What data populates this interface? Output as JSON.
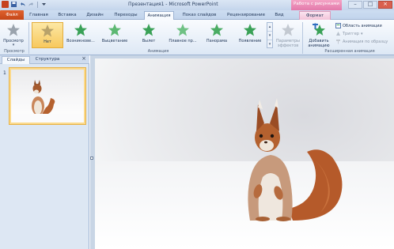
{
  "titlebar": {
    "title": "Презентация1 - Microsoft PowerPoint",
    "context_header": "Работа с рисунками"
  },
  "tabs": [
    {
      "label": "Файл"
    },
    {
      "label": "Главная"
    },
    {
      "label": "Вставка"
    },
    {
      "label": "Дизайн"
    },
    {
      "label": "Переходы"
    },
    {
      "label": "Анимация"
    },
    {
      "label": "Показ слайдов"
    },
    {
      "label": "Рецензирование"
    },
    {
      "label": "Вид"
    },
    {
      "label": "Формат"
    }
  ],
  "ribbon": {
    "preview": {
      "label": "Просмотр",
      "group_label": "Просмотр"
    },
    "animation_gallery": [
      {
        "label": "Нет"
      },
      {
        "label": "Возникнове..."
      },
      {
        "label": "Выцветание"
      },
      {
        "label": "Вылет"
      },
      {
        "label": "Плавное пр..."
      },
      {
        "label": "Панорама"
      },
      {
        "label": "Появление"
      }
    ],
    "effect_params": {
      "label_line1": "Параметры",
      "label_line2": "эффектов"
    },
    "animation_group_label": "Анимация",
    "add_animation": {
      "label_line1": "Добавить",
      "label_line2": "анимацию"
    },
    "animation_area": "Область анимации",
    "trigger": "Триггер",
    "animation_painter": "Анимация по образцу",
    "advanced_group_label": "Расширенная анимация"
  },
  "left_pane": {
    "tab_slides": "Слайды",
    "tab_outline": "Структура",
    "close_glyph": "×",
    "slide_number": "1"
  },
  "colors": {
    "file_tab": "#c44618",
    "context_tab": "#e37aab",
    "selected_item": "#f7c95e",
    "star_green": "#3aa157",
    "squirrel_fur": "#b55a2a"
  }
}
